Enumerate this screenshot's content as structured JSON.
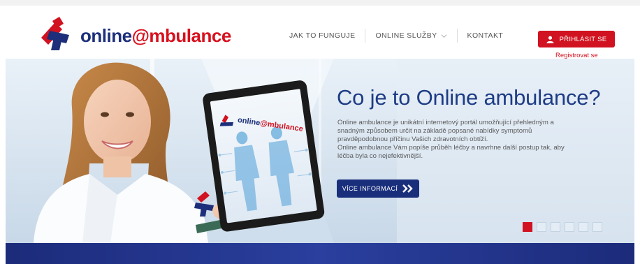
{
  "brand": {
    "name_part1": "online",
    "name_part2": "@mbulance",
    "tablet_logo_part1": "online",
    "tablet_logo_part2": "@mbulance",
    "colors": {
      "blue": "#1d2f7a",
      "red": "#d11220"
    }
  },
  "nav": {
    "items": [
      {
        "label": "JAK TO FUNGUJE"
      },
      {
        "label": "ONLINE SLUŽBY",
        "icon": "chevron-down-icon"
      },
      {
        "label": "KONTAKT"
      }
    ]
  },
  "account": {
    "login_label": "PŘIHLÁSIT SE",
    "login_icon": "user-icon",
    "register_label": "Registrovat se"
  },
  "hero": {
    "title": "Co je to Online ambulance?",
    "description_1": "Online ambulance je unikátní internetový portál umožňující přehledným a snadným způsobem určit na základě popsané nabídky symptomů pravděpodobnou příčinu Vašich zdravotních obtíží.",
    "description_2": "Online ambulance Vám popíše průběh léčby a navrhne další postup tak, aby léčba byla co nejefektivnější.",
    "button_label": "VÍCE INFORMACÍ",
    "button_icon": "double-chevron-right-icon"
  },
  "slider": {
    "count": 6,
    "active_index": 0
  }
}
